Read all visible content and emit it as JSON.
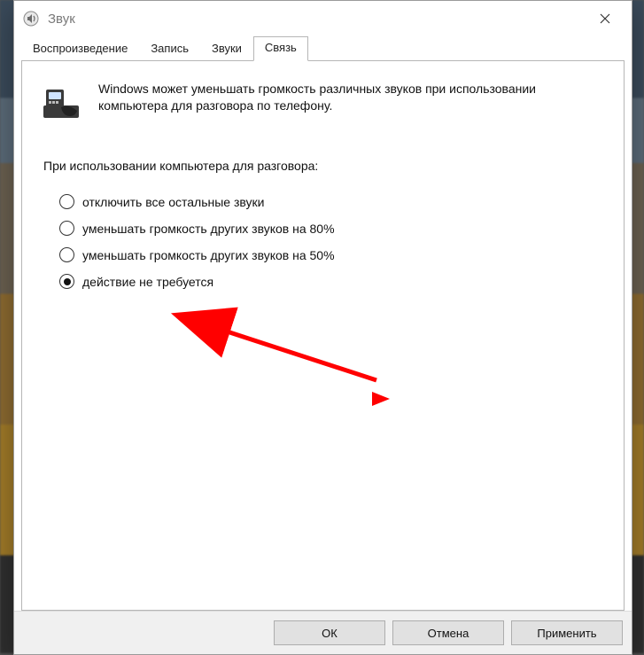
{
  "window": {
    "title": "Звук"
  },
  "tabs": {
    "playback": "Воспроизведение",
    "record": "Запись",
    "sounds": "Звуки",
    "comm": "Связь"
  },
  "comm_panel": {
    "intro": "Windows может уменьшать громкость различных звуков при использовании компьютера для разговора по телефону.",
    "group_label": "При использовании компьютера для разговора:",
    "options": {
      "mute": "отключить все остальные звуки",
      "reduce80": "уменьшать громкость других звуков на 80%",
      "reduce50": "уменьшать громкость других звуков на 50%",
      "none": "действие не требуется"
    },
    "selected": "none"
  },
  "buttons": {
    "ok": "ОК",
    "cancel": "Отмена",
    "apply": "Применить"
  }
}
